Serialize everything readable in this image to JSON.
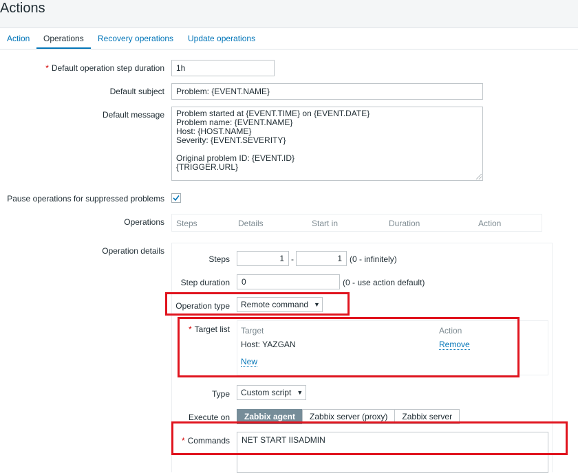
{
  "page": {
    "title": "Actions"
  },
  "tabs": [
    "Action",
    "Operations",
    "Recovery operations",
    "Update operations"
  ],
  "form": {
    "step_duration": {
      "label": "Default operation step duration",
      "value": "1h"
    },
    "subject": {
      "label": "Default subject",
      "value": "Problem: {EVENT.NAME}"
    },
    "message": {
      "label": "Default message",
      "lines": [
        "Problem started at {EVENT.TIME} on {EVENT.DATE}",
        "Problem name: {EVENT.NAME}",
        "Host: {HOST.NAME}",
        "Severity: {EVENT.SEVERITY}",
        "",
        "Original problem ID: {EVENT.ID}",
        "{TRIGGER.URL}"
      ]
    },
    "pause": {
      "label": "Pause operations for suppressed problems",
      "checked": true
    },
    "operations": {
      "label": "Operations",
      "columns": [
        "Steps",
        "Details",
        "Start in",
        "Duration",
        "Action"
      ]
    },
    "details": {
      "label": "Operation details",
      "steps": {
        "label": "Steps",
        "from": "1",
        "separator": "-",
        "to": "1",
        "hint": "(0 - infinitely)"
      },
      "step_duration": {
        "label": "Step duration",
        "value": "0",
        "hint": "(0 - use action default)"
      },
      "operation_type": {
        "label": "Operation type",
        "value": "Remote command"
      },
      "target_list": {
        "label": "Target list",
        "col_target": "Target",
        "col_action": "Action",
        "target": "Host: YAZGAN",
        "remove": "Remove",
        "new": "New"
      },
      "type": {
        "label": "Type",
        "value": "Custom script"
      },
      "execute_on": {
        "label": "Execute on",
        "options": [
          "Zabbix agent",
          "Zabbix server (proxy)",
          "Zabbix server"
        ],
        "selected": "Zabbix agent"
      },
      "commands": {
        "label": "Commands",
        "value": "NET START IISADMIN"
      }
    }
  },
  "colors": {
    "accent": "#0275b8",
    "highlight": "#e0141e",
    "required": "#d40000",
    "selected_radio": "#768d99"
  }
}
